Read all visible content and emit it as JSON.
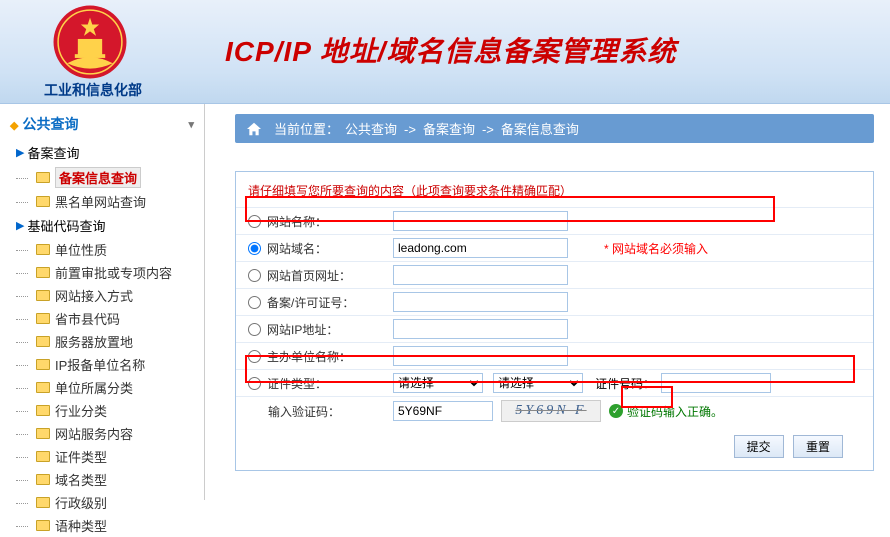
{
  "header": {
    "ministry": "工业和信息化部",
    "system_title": "ICP/IP 地址/域名信息备案管理系统"
  },
  "sidebar": {
    "section_title": "公共查询",
    "groups": [
      {
        "label": "备案查询",
        "items": [
          {
            "label": "备案信息查询",
            "active": true
          },
          {
            "label": "黑名单网站查询",
            "active": false
          }
        ]
      },
      {
        "label": "基础代码查询",
        "items": [
          {
            "label": "单位性质"
          },
          {
            "label": "前置审批或专项内容"
          },
          {
            "label": "网站接入方式"
          },
          {
            "label": "省市县代码"
          },
          {
            "label": "服务器放置地"
          },
          {
            "label": "IP报备单位名称"
          },
          {
            "label": "单位所属分类"
          },
          {
            "label": "行业分类"
          },
          {
            "label": "网站服务内容"
          },
          {
            "label": "证件类型"
          },
          {
            "label": "域名类型"
          },
          {
            "label": "行政级别"
          },
          {
            "label": "语种类型"
          }
        ]
      }
    ]
  },
  "breadcrumb": {
    "prefix": "当前位置：",
    "items": [
      "公共查询",
      "备案查询",
      "备案信息查询"
    ],
    "sep": "->"
  },
  "panel": {
    "instruction": "请仔细填写您所要查询的内容（此项查询要求条件精确匹配）",
    "rows": [
      {
        "key": "site_name",
        "label": "网站名称："
      },
      {
        "key": "site_domain",
        "label": "网站域名：",
        "value": "leadong.com",
        "checked": true,
        "note": "* 网站域名必须输入"
      },
      {
        "key": "site_home",
        "label": "网站首页网址："
      },
      {
        "key": "record_no",
        "label": "备案/许可证号："
      },
      {
        "key": "site_ip",
        "label": "网站IP地址："
      },
      {
        "key": "sponsor",
        "label": "主办单位名称："
      }
    ],
    "cert_row": {
      "label": "证件类型：",
      "select_placeholder": "请选择",
      "cert_no_label": "证件号码："
    },
    "captcha_row": {
      "label": "输入验证码：",
      "value": "5Y69NF",
      "image_text": "5Y69N F",
      "ok_msg": "验证码输入正确。"
    },
    "buttons": {
      "submit": "提交",
      "reset": "重置"
    }
  }
}
